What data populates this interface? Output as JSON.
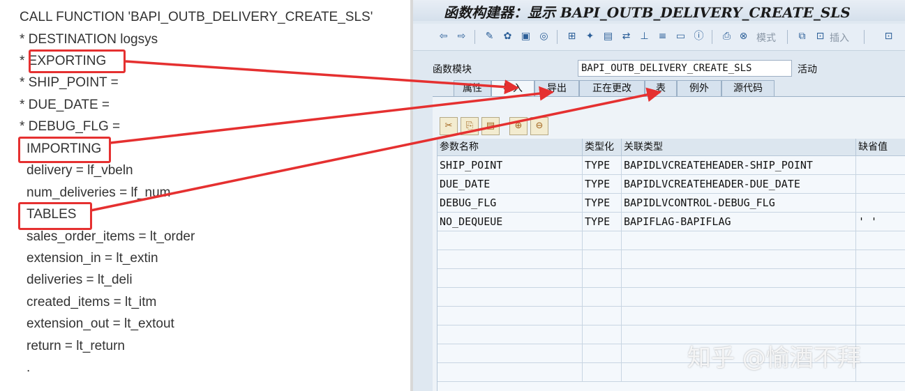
{
  "code": {
    "lines": [
      "CALL FUNCTION 'BAPI_OUTB_DELIVERY_CREATE_SLS'",
      "*   DESTINATION logsys",
      "*   EXPORTING",
      "*     SHIP_POINT              =",
      "*     DUE_DATE                =",
      "*     DEBUG_FLG               =",
      "IMPORTING",
      "    delivery               = lf_vbeln",
      "    num_deliveries         = lf_num",
      "TABLES",
      "    sales_order_items       = lt_order",
      "    extension_in            = lt_extin",
      "    deliveries              = lt_deli",
      "    created_items           = lt_itm",
      "    extension_out           = lt_extout",
      "    return                  = lt_return",
      "          ."
    ],
    "accent": "#e53030"
  },
  "sap": {
    "title": "函数构建器：显示 BAPI_OUTB_DELIVERY_CREATE_SLS",
    "toolbar": {
      "mode_label": "模式",
      "insert_label": "插入"
    },
    "function_module_label": "函数模块",
    "function_module_value": "BAPI_OUTB_DELIVERY_CREATE_SLS",
    "status": "活动",
    "tabs": [
      "属性",
      "导入",
      "导出",
      "正在更改",
      "表",
      "例外",
      "源代码"
    ],
    "active_tab": "导入",
    "columns": [
      "参数名称",
      "类型化",
      "关联类型",
      "缺省值"
    ],
    "rows": [
      {
        "name": "SHIP_POINT",
        "typing": "TYPE",
        "assoc": "BAPIDLVCREATEHEADER-SHIP_POINT",
        "default": ""
      },
      {
        "name": "DUE_DATE",
        "typing": "TYPE",
        "assoc": "BAPIDLVCREATEHEADER-DUE_DATE",
        "default": ""
      },
      {
        "name": "DEBUG_FLG",
        "typing": "TYPE",
        "assoc": "BAPIDLVCONTROL-DEBUG_FLG",
        "default": ""
      },
      {
        "name": "NO_DEQUEUE",
        "typing": "TYPE",
        "assoc": "BAPIFLAG-BAPIFLAG",
        "default": "' '"
      }
    ]
  },
  "watermark": "知乎 @愉酒不拜"
}
